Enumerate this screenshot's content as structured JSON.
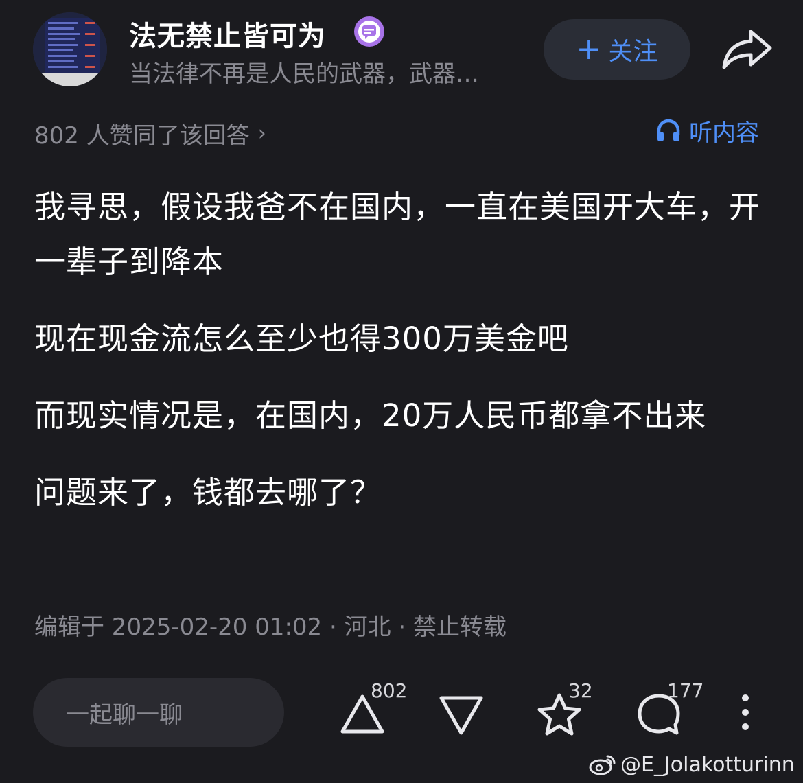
{
  "author": {
    "name": "法无禁止皆可为",
    "bio": "当法律不再是人民的武器，武器…"
  },
  "follow_button": {
    "label": "关注"
  },
  "agree": {
    "text": "802 人赞同了该回答"
  },
  "listen": {
    "label": "听内容"
  },
  "content": {
    "paragraphs": [
      "我寻思，假设我爸不在国内，一直在美国开大车，开一辈子到降本",
      "现在现金流怎么至少也得300万美金吧",
      "而现实情况是，在国内，20万人民币都拿不出来",
      "问题来了，钱都去哪了？"
    ]
  },
  "edit_info": "编辑于 2025-02-20 01:02 · 河北 · 禁止转载",
  "action_bar": {
    "chat_placeholder": "一起聊一聊",
    "upvote_count": "802",
    "favorite_count": "32",
    "comment_count": "177"
  },
  "watermark": "@E_Jolakotturinn",
  "colors": {
    "background": "#1b1b1f",
    "accent": "#4f8ff7",
    "muted_text": "#8a8a92",
    "button_bg": "#2a2d36",
    "badge_purple": "#a873e8"
  },
  "icons": [
    "avatar",
    "chat-badge-icon",
    "plus-icon",
    "share-icon",
    "chevron-right-icon",
    "headphones-icon",
    "upvote-icon",
    "downvote-icon",
    "star-icon",
    "comment-icon",
    "more-icon",
    "weibo-icon"
  ]
}
